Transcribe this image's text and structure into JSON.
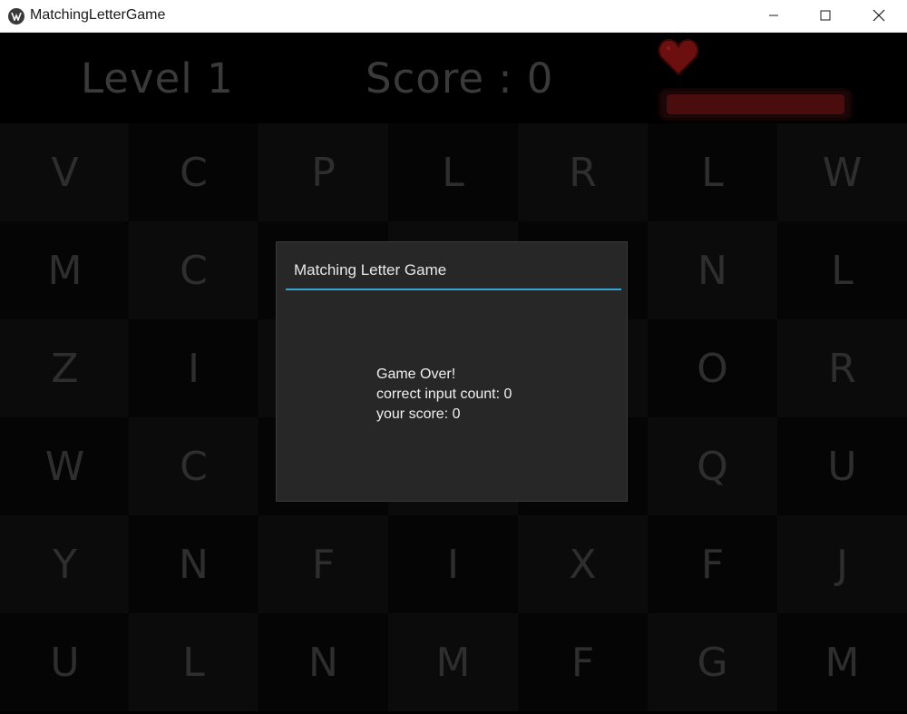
{
  "window": {
    "title": "MatchingLetterGame",
    "controls": [
      "minimize",
      "maximize",
      "close"
    ]
  },
  "hud": {
    "level": "Level 1",
    "score": "Score : 0",
    "health_icon": "heart-icon",
    "health_fraction": 1.0
  },
  "grid": {
    "rows": [
      [
        "V",
        "C",
        "P",
        "L",
        "R",
        "L",
        "W"
      ],
      [
        "M",
        "C",
        "",
        "",
        "",
        "N",
        "L"
      ],
      [
        "Z",
        "I",
        "",
        "",
        "",
        "O",
        "R"
      ],
      [
        "W",
        "C",
        "",
        "",
        "",
        "Q",
        "U"
      ],
      [
        "Y",
        "N",
        "F",
        "I",
        "X",
        "F",
        "J"
      ],
      [
        "U",
        "L",
        "N",
        "M",
        "F",
        "G",
        "M"
      ]
    ]
  },
  "popup": {
    "title": "Matching Letter Game",
    "line1": "Game Over!",
    "line2": "correct input count: 0",
    "line3": "your score: 0"
  },
  "colors": {
    "accent": "#33a5d6",
    "health": "#4a0c0c",
    "heart": "#6b0f0f"
  }
}
